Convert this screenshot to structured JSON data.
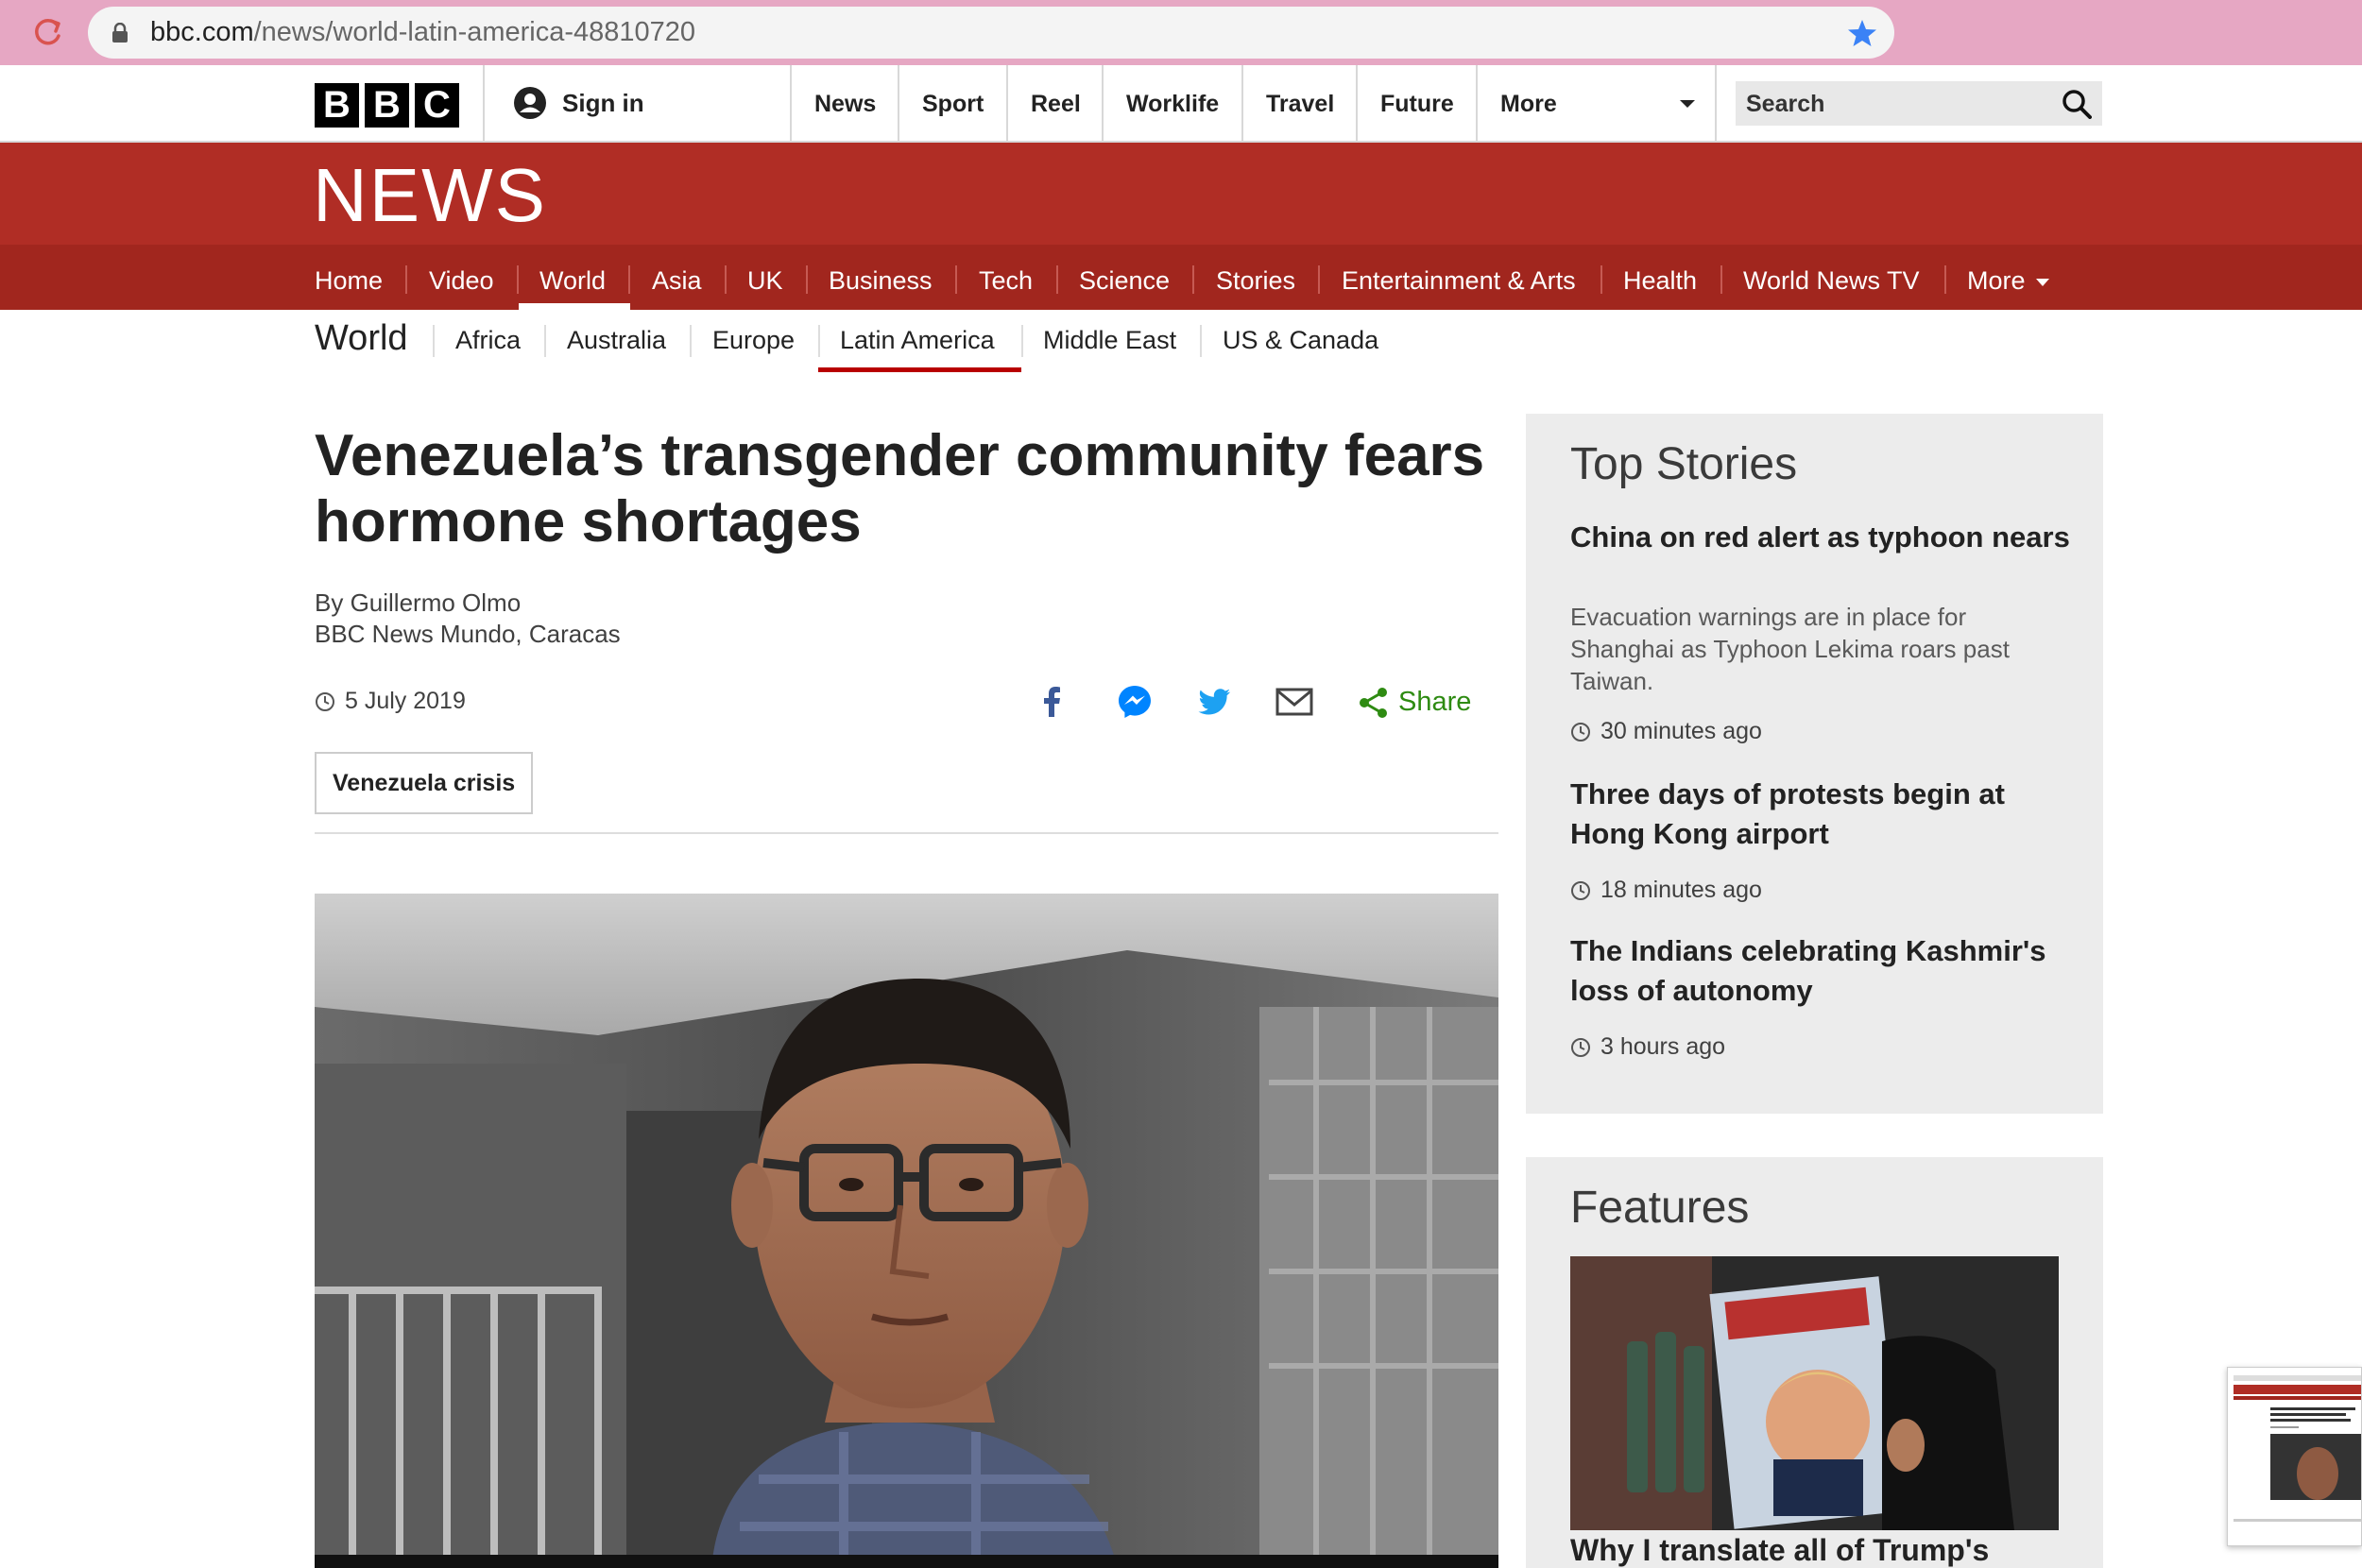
{
  "browser": {
    "url_domain": "bbc.com",
    "url_path": "/news/world-latin-america-48810720"
  },
  "topbar": {
    "logo": [
      "B",
      "B",
      "C"
    ],
    "sign_in": "Sign in",
    "nav": [
      "News",
      "Sport",
      "Reel",
      "Worklife",
      "Travel",
      "Future",
      "More"
    ],
    "search_label": "Search"
  },
  "news_band": {
    "title": "NEWS"
  },
  "news_nav": {
    "items": [
      "Home",
      "Video",
      "World",
      "Asia",
      "UK",
      "Business",
      "Tech",
      "Science",
      "Stories",
      "Entertainment & Arts",
      "Health",
      "World News TV",
      "More"
    ],
    "active": "World"
  },
  "world_nav": {
    "title": "World",
    "items": [
      "Africa",
      "Australia",
      "Europe",
      "Latin America",
      "Middle East",
      "US & Canada"
    ],
    "active": "Latin America"
  },
  "article": {
    "headline": "Venezuela’s transgender community fears hormone shortages",
    "author": "By Guillermo Olmo",
    "outlet": "BBC News Mundo, Caracas",
    "date": "5 July 2019",
    "share_label": "Share",
    "tag": "Venezuela crisis"
  },
  "top_stories": {
    "title": "Top Stories",
    "items": [
      {
        "title": "China on red alert as typhoon nears",
        "summary": "Evacuation warnings are in place for Shanghai as Typhoon Lekima roars past Taiwan.",
        "time": "30 minutes ago"
      },
      {
        "title": "Three days of protests begin at Hong Kong airport",
        "summary": "",
        "time": "18 minutes ago"
      },
      {
        "title": "The Indians celebrating Kashmir's loss of autonomy",
        "summary": "",
        "time": "3 hours ago"
      }
    ]
  },
  "features": {
    "title": "Features",
    "first_title": "Why I translate all of Trump's"
  },
  "colors": {
    "chrome": "#e6a7c3",
    "news_red": "#b02d25",
    "news_nav_red": "#a1261e",
    "share_green": "#2e8b12",
    "facebook": "#3b5998",
    "messenger": "#0084ff",
    "twitter": "#1da1f2",
    "active_underline": "#b80000"
  }
}
